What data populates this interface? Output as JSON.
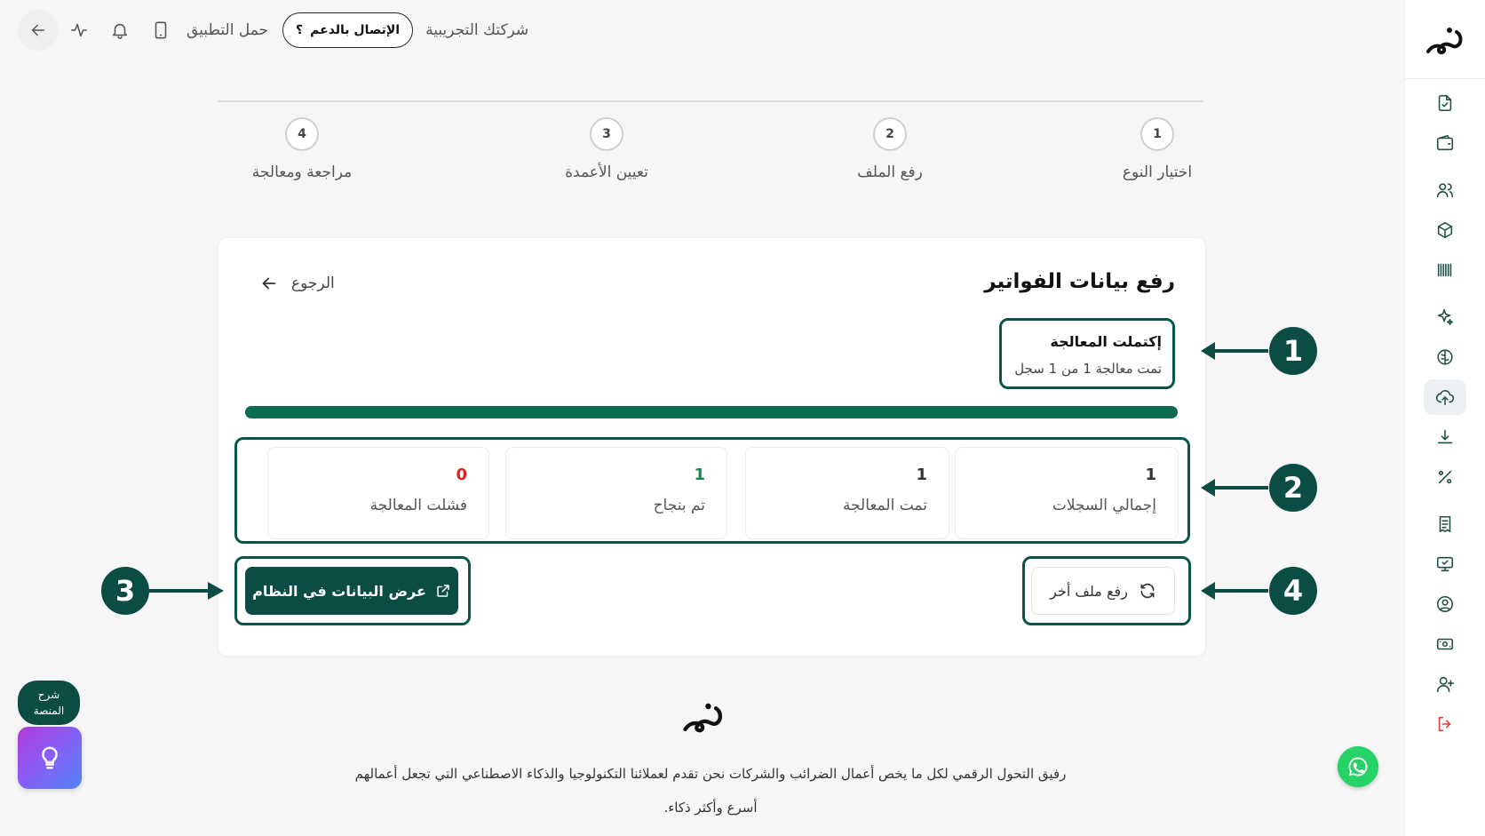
{
  "topbar": {
    "download_app": "حمل التطبيق",
    "support_button": "الإتصال بالدعم",
    "support_glyph": "؟",
    "company_name": "شركتك التجريبية"
  },
  "stepper": [
    {
      "number": "1",
      "label": "اختيار النوع"
    },
    {
      "number": "2",
      "label": "رفع الملف"
    },
    {
      "number": "3",
      "label": "تعيين الأعمدة"
    },
    {
      "number": "4",
      "label": "مراجعة ومعالجة"
    }
  ],
  "card": {
    "title": "رفع بيانات الفواتير",
    "back_label": "الرجوع",
    "status_title": "إكتملت المعالجة",
    "status_sub": "تمت معالجة 1 من 1 سجل",
    "progress": 1.0,
    "stats": [
      {
        "value": "1",
        "label": "إجمالي السجلات",
        "color": "#222222"
      },
      {
        "value": "1",
        "label": "تمت المعالجة",
        "color": "#222222"
      },
      {
        "value": "1",
        "label": "تم بنجاح",
        "color": "#1a8a4a"
      },
      {
        "value": "0",
        "label": "فشلت المعالجة",
        "color": "#e02020"
      }
    ],
    "view_data_button": "عرض البيانات في النظام",
    "upload_another_button": "رفع ملف أخر"
  },
  "callouts": [
    "1",
    "2",
    "3",
    "4"
  ],
  "footer": {
    "line1": "رفيق التحول الرقمي لكل ما يخص أعمال الضرائب والشركات نحن تقدم لعملائنا التكنولوجيا والذكاء الاصطناعي التي تجعل أعمالهم",
    "line2": "أسرع وأكثر ذكاء."
  },
  "help": {
    "label_line1": "شرح",
    "label_line2": "المنصة"
  },
  "colors": {
    "brand": "#0b4d44",
    "progress": "#0a6b4e",
    "success": "#1a8a4a",
    "danger": "#e02020"
  }
}
